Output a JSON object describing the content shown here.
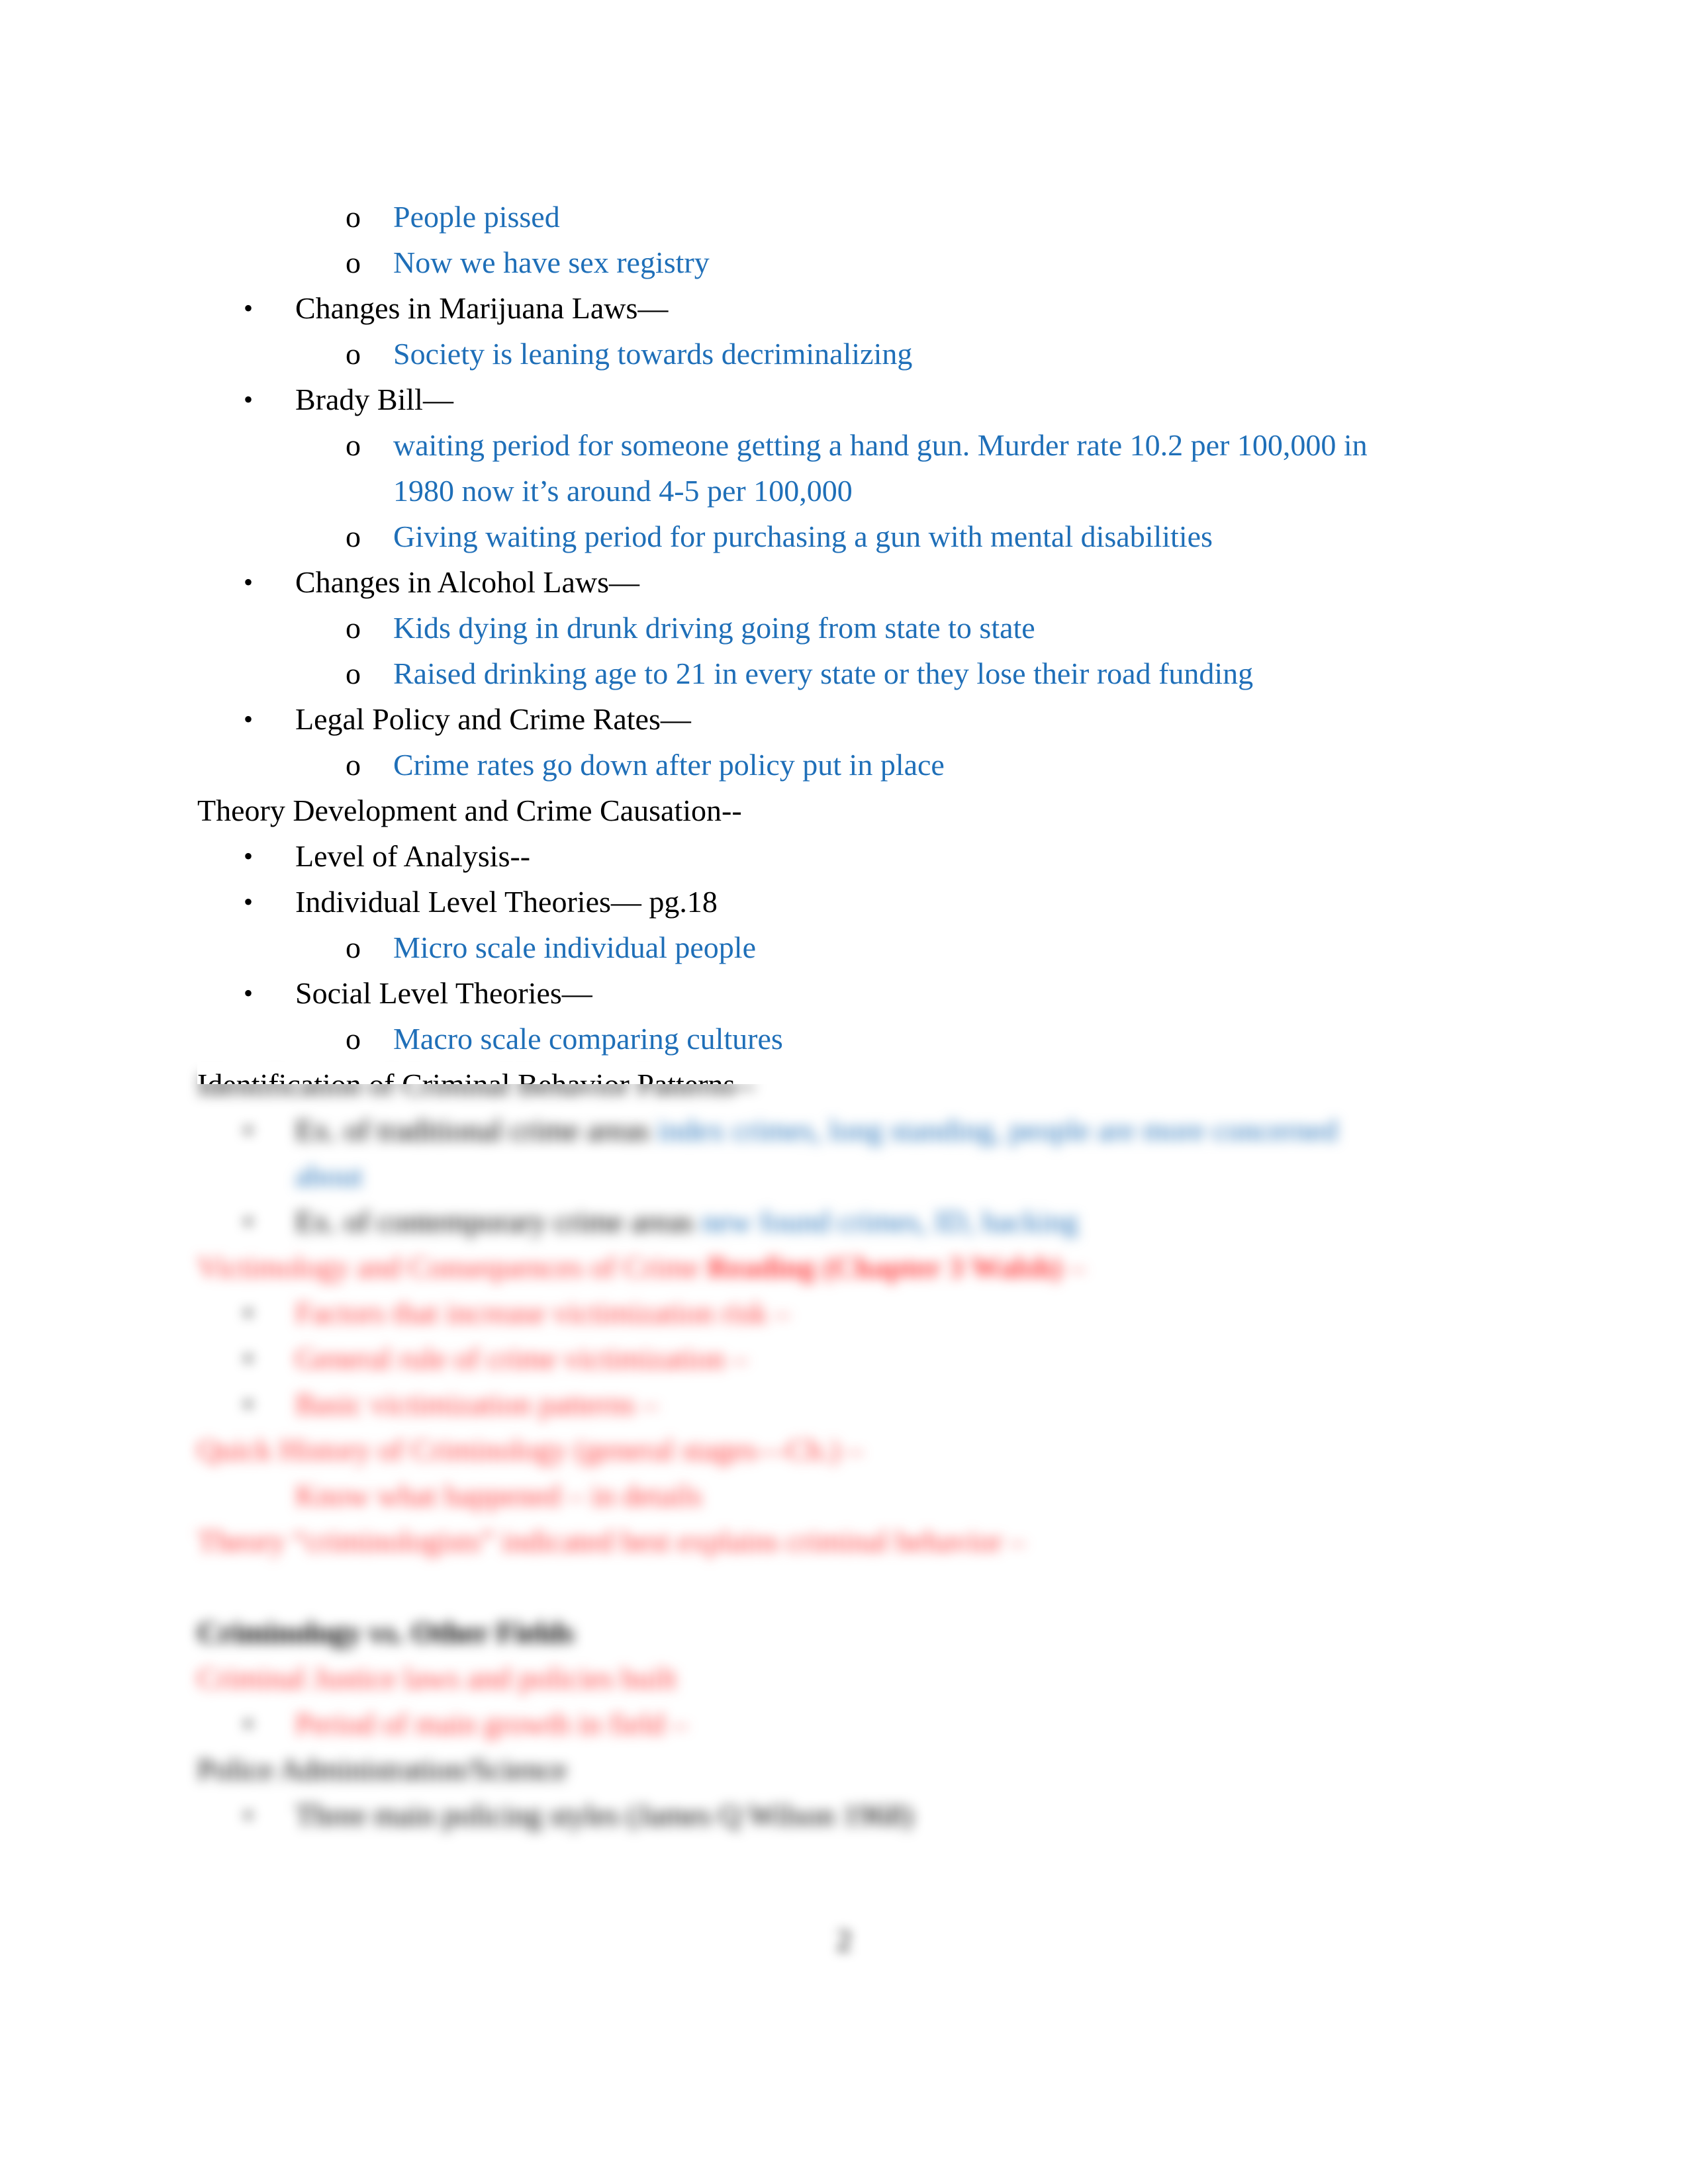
{
  "colors": {
    "note_blue": "#1f6fb8",
    "heading_red": "#ff3b3b",
    "text": "#000000"
  },
  "lines": {
    "l1": "People pissed",
    "l2": "Now we have sex registry",
    "l3": "Changes in Marijuana Laws—",
    "l4": "Society is leaning towards decriminalizing",
    "l5": "Brady Bill—",
    "l6a": "waiting period for someone getting a hand gun. Murder rate 10.2 per 100,000 in",
    "l6b": "1980 now it’s around 4-5 per 100,000",
    "l7": "Giving waiting period for purchasing a gun with mental disabilities",
    "l8": "Changes in Alcohol Laws—",
    "l9": "Kids dying in drunk driving going from state to state",
    "l10": "Raised drinking age to 21 in every state or they lose their road funding",
    "l11": "Legal Policy and Crime Rates—",
    "l12": "Crime rates go down after policy put in place",
    "l13": "Theory Development and Crime Causation--",
    "l14": "Level of Analysis--",
    "l15": "Individual Level Theories— pg.18",
    "l16": "Micro scale  individual people",
    "l17": "Social Level Theories—",
    "l18": "Macro scale  comparing cultures",
    "l19": "Identification of Criminal Behavior Patterns--"
  },
  "blurred": {
    "b1a": "Ex. of traditional crime areas ",
    "b1b": "index crimes, long standing, people are more concerned",
    "b1c": "about",
    "b2a": "Ex. of contemporary crime areas ",
    "b2b": "new found crimes, ID, hacking",
    "b3a": "Victimology and Consequences of Crime ",
    "b3b": "Reading (Chapter 3 Walsh)",
    "b3c": " –",
    "b4": "Factors that increase victimization risk –",
    "b5": "General rule of crime victimization –",
    "b6": "Basic victimization patterns –",
    "b7": "Quick History of Criminology (general stages—Ch.) –",
    "b8": "Know what happened – in details",
    "b9": "Theory “criminologists” indicated best explains criminal behavior –",
    "b10": "Criminology vs. Other Fields",
    "b11": "Criminal Justice  laws and policies built",
    "b12": "Period of main growth in field –",
    "b13": "Police Administration/Science",
    "b14": "Three main policing styles (James Q Wilson 1968)"
  },
  "markers": {
    "bullet": "•",
    "sub": "o"
  },
  "page_number": "2"
}
